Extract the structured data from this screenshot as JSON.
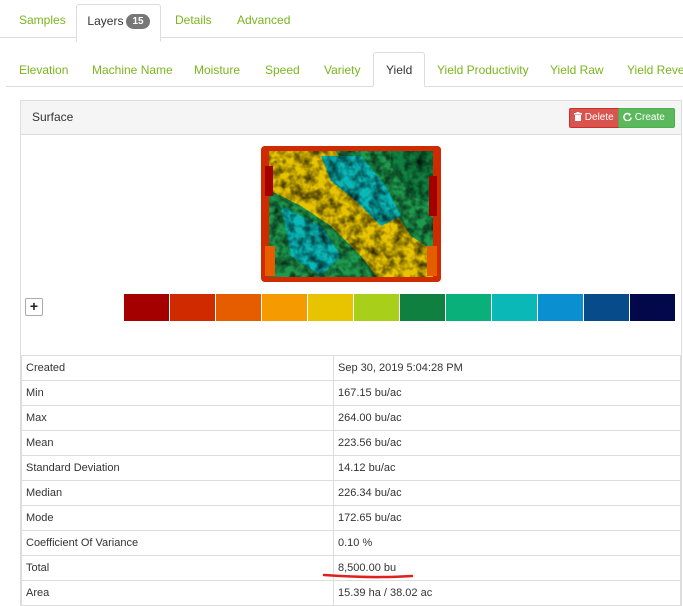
{
  "top_tabs": [
    {
      "label": "Samples"
    },
    {
      "label": "Layers",
      "badge": "15"
    },
    {
      "label": "Details"
    },
    {
      "label": "Advanced"
    }
  ],
  "sub_tabs": [
    {
      "label": "Elevation"
    },
    {
      "label": "Machine Name"
    },
    {
      "label": "Moisture"
    },
    {
      "label": "Speed"
    },
    {
      "label": "Variety"
    },
    {
      "label": "Yield"
    },
    {
      "label": "Yield Productivity"
    },
    {
      "label": "Yield Raw"
    },
    {
      "label": "Yield Revenue"
    }
  ],
  "panel": {
    "title": "Surface",
    "delete_label": "Delete",
    "create_label": "Create"
  },
  "legend_colors": [
    "#a50000",
    "#cf2a00",
    "#e65d00",
    "#f59a00",
    "#e8c400",
    "#a8cf1a",
    "#108040",
    "#0ab07a",
    "#0ab8b8",
    "#0a90d0",
    "#084b8a",
    "#03084a"
  ],
  "stats": [
    {
      "label": "Created",
      "value": "Sep 30, 2019 5:04:28 PM"
    },
    {
      "label": "Min",
      "value": "167.15 bu/ac"
    },
    {
      "label": "Max",
      "value": "264.00 bu/ac"
    },
    {
      "label": "Mean",
      "value": "223.56 bu/ac"
    },
    {
      "label": "Standard Deviation",
      "value": "14.12 bu/ac"
    },
    {
      "label": "Median",
      "value": "226.34 bu/ac"
    },
    {
      "label": "Mode",
      "value": "172.65 bu/ac"
    },
    {
      "label": "Coefficient Of Variance",
      "value": "0.10 %"
    },
    {
      "label": "Total",
      "value": "8,500.00 bu"
    },
    {
      "label": "Area",
      "value": "15.39 ha / 38.02 ac"
    }
  ]
}
